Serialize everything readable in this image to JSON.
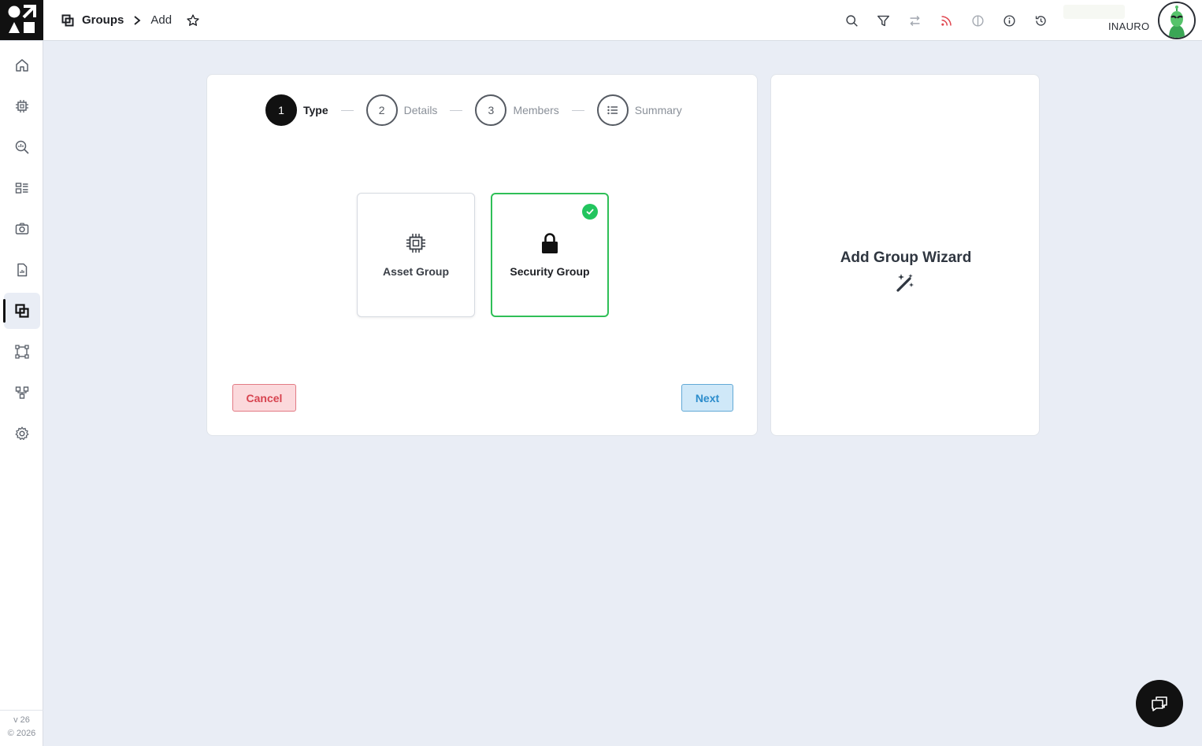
{
  "breadcrumb": {
    "section": "Groups",
    "page": "Add"
  },
  "user": {
    "name": "INAURO"
  },
  "sidebar": {
    "items": [
      {
        "icon": "home-icon"
      },
      {
        "icon": "chip-icon"
      },
      {
        "icon": "search-analytics-icon"
      },
      {
        "icon": "dashboard-icon"
      },
      {
        "icon": "camera-icon"
      },
      {
        "icon": "report-icon"
      },
      {
        "icon": "groups-icon",
        "active": true
      },
      {
        "icon": "frame-icon"
      },
      {
        "icon": "hierarchy-icon"
      },
      {
        "icon": "settings-icon"
      }
    ],
    "version": "v 26",
    "copyright": "© 2026"
  },
  "topbar_icons": [
    "search-icon",
    "filter-icon",
    "swap-icon",
    "rss-icon",
    "contrast-icon",
    "info-icon",
    "history-icon"
  ],
  "wizard": {
    "steps": [
      {
        "number": "1",
        "label": "Type",
        "active": true
      },
      {
        "number": "2",
        "label": "Details"
      },
      {
        "number": "3",
        "label": "Members"
      },
      {
        "number": "",
        "label": "Summary"
      }
    ],
    "types": [
      {
        "label": "Asset Group",
        "icon": "chip-icon",
        "selected": false
      },
      {
        "label": "Security Group",
        "icon": "lock-icon",
        "selected": true
      }
    ],
    "cancel_label": "Cancel",
    "next_label": "Next"
  },
  "info_panel": {
    "title": "Add Group Wizard"
  },
  "colors": {
    "accent_green": "#22c55e",
    "cancel_red": "#d7434f",
    "next_blue": "#2c8dcc",
    "background": "#e9edf5"
  }
}
